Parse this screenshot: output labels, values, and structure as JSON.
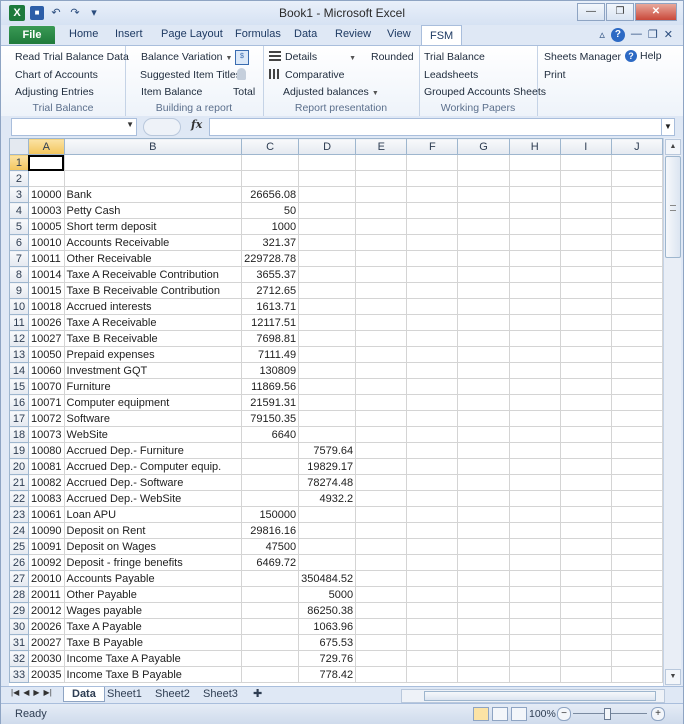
{
  "window": {
    "title": "Book1 - Microsoft Excel"
  },
  "tabs": {
    "file": "File",
    "items": [
      "Home",
      "Insert",
      "Page Layout",
      "Formulas",
      "Data",
      "Review",
      "View",
      "FSM"
    ]
  },
  "ribbon": {
    "trial_balance": {
      "items": [
        "Read Trial Balance Data",
        "Chart of Accounts",
        "Adjusting Entries"
      ],
      "label": "Trial Balance"
    },
    "building_report": {
      "balance_variation": "Balance Variation",
      "suggested_item_titles": "Suggested Item Titles",
      "item_balance": "Item Balance",
      "total": "Total",
      "label": "Building a report"
    },
    "report_presentation": {
      "details": "Details",
      "rounded": "Rounded",
      "comparative": "Comparative",
      "adjusted_balances": "Adjusted balances",
      "label": "Report presentation"
    },
    "working_papers": {
      "items": [
        "Trial Balance",
        "Leadsheets",
        "Grouped Accounts Sheets"
      ],
      "label": "Working Papers"
    },
    "misc": {
      "sheets_manager": "Sheets Manager",
      "help": "Help",
      "print": "Print"
    }
  },
  "formula_bar": {
    "name_box": "",
    "fx": "fx",
    "content": ""
  },
  "grid": {
    "columns": [
      "A",
      "B",
      "C",
      "D",
      "E",
      "F",
      "G",
      "H",
      "I",
      "J"
    ],
    "rows": [
      [
        "1",
        "",
        "",
        "",
        ""
      ],
      [
        "2",
        "",
        "",
        "",
        ""
      ],
      [
        "3",
        "10000",
        "Bank",
        "26656.08",
        ""
      ],
      [
        "4",
        "10003",
        "Petty Cash",
        "50",
        ""
      ],
      [
        "5",
        "10005",
        "Short term deposit",
        "1000",
        ""
      ],
      [
        "6",
        "10010",
        "Accounts Receivable",
        "321.37",
        ""
      ],
      [
        "7",
        "10011",
        "Other Receivable",
        "229728.78",
        ""
      ],
      [
        "8",
        "10014",
        "Taxe A Receivable Contribution",
        "3655.37",
        ""
      ],
      [
        "9",
        "10015",
        "Taxe B Receivable Contribution",
        "2712.65",
        ""
      ],
      [
        "10",
        "10018",
        "Accrued interests",
        "1613.71",
        ""
      ],
      [
        "11",
        "10026",
        "Taxe A Receivable",
        "12117.51",
        ""
      ],
      [
        "12",
        "10027",
        "Taxe B Receivable",
        "7698.81",
        ""
      ],
      [
        "13",
        "10050",
        "Prepaid expenses",
        "7111.49",
        ""
      ],
      [
        "14",
        "10060",
        "Investment GQT",
        "130809",
        ""
      ],
      [
        "15",
        "10070",
        "Furniture",
        "11869.56",
        ""
      ],
      [
        "16",
        "10071",
        "Computer equipment",
        "21591.31",
        ""
      ],
      [
        "17",
        "10072",
        "Software",
        "79150.35",
        ""
      ],
      [
        "18",
        "10073",
        "WebSite",
        "6640",
        ""
      ],
      [
        "19",
        "10080",
        "Accrued Dep.- Furniture",
        "",
        "7579.64"
      ],
      [
        "20",
        "10081",
        "Accrued Dep.- Computer equip.",
        "",
        "19829.17"
      ],
      [
        "21",
        "10082",
        "Accrued Dep.- Software",
        "",
        "78274.48"
      ],
      [
        "22",
        "10083",
        "Accrued Dep.- WebSite",
        "",
        "4932.2"
      ],
      [
        "23",
        "10061",
        "Loan APU",
        "150000",
        ""
      ],
      [
        "24",
        "10090",
        "Deposit on Rent",
        "29816.16",
        ""
      ],
      [
        "25",
        "10091",
        "Deposit on Wages",
        "47500",
        ""
      ],
      [
        "26",
        "10092",
        "Deposit - fringe benefits",
        "6469.72",
        ""
      ],
      [
        "27",
        "20010",
        "Accounts Payable",
        "",
        "350484.52"
      ],
      [
        "28",
        "20011",
        "Other Payable",
        "",
        "5000"
      ],
      [
        "29",
        "20012",
        "Wages payable",
        "",
        "86250.38"
      ],
      [
        "30",
        "20026",
        "Taxe A Payable",
        "",
        "1063.96"
      ],
      [
        "31",
        "20027",
        "Taxe B Payable",
        "",
        "675.53"
      ],
      [
        "32",
        "20030",
        "Income Taxe A Payable",
        "",
        "729.76"
      ],
      [
        "33",
        "20035",
        "Income Taxe B Payable",
        "",
        "778.42"
      ]
    ]
  },
  "sheets": [
    "Data",
    "Sheet1",
    "Sheet2",
    "Sheet3"
  ],
  "status": {
    "ready": "Ready",
    "zoom": "100%"
  },
  "colors": {
    "file_tab": "#1f7a3b",
    "selection": "#f2c55b"
  }
}
